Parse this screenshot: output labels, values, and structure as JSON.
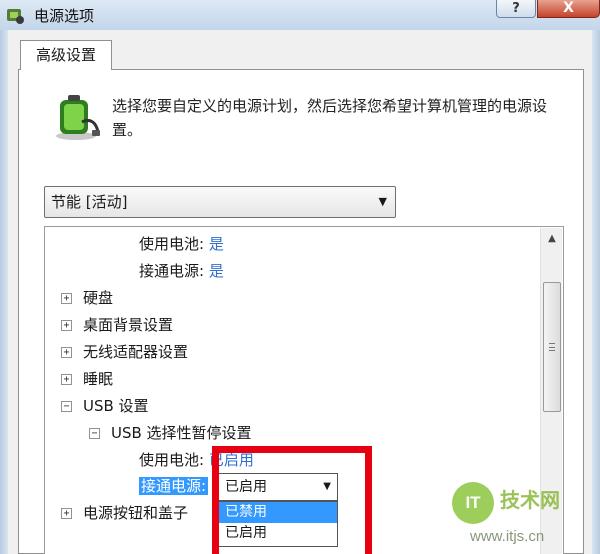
{
  "window": {
    "title": "电源选项",
    "help_label": "?",
    "close_label": "X"
  },
  "tab": {
    "label": "高级设置"
  },
  "description": "选择您要自定义的电源计划，然后选择您希望计算机管理的电源设置。",
  "plan_select": {
    "value": "节能 [活动]"
  },
  "tree": {
    "battery_label": "使用电池:",
    "battery_value": "是",
    "plugged_label": "接通电源:",
    "plugged_value": "是",
    "items": [
      "硬盘",
      "桌面背景设置",
      "无线适配器设置",
      "睡眠"
    ],
    "usb": "USB 设置",
    "usb_suspend": "USB 选择性暂停设置",
    "usb_battery_label": "使用电池:",
    "usb_battery_value": "已启用",
    "usb_plugged_label": "接通电源:",
    "power_buttons": "电源按钮和盖子"
  },
  "dropdown": {
    "value": "已启用",
    "options": [
      "已禁用",
      "已启用"
    ],
    "selected_index": 0
  },
  "watermark": {
    "logo": "IT",
    "text": "技术网",
    "url": "www.itjs.cn"
  },
  "colors": {
    "value_blue": "#2f6fd0",
    "highlight": "#3399ff",
    "annotation_red": "#e60012"
  }
}
